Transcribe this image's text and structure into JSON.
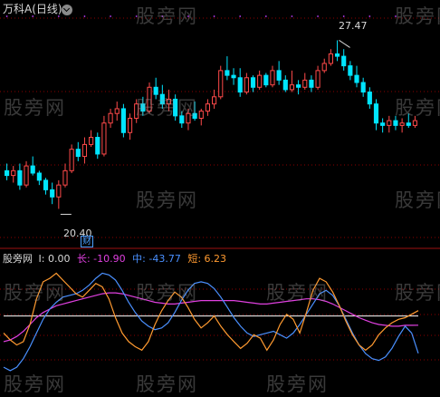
{
  "header": {
    "title": "万科A(日线)"
  },
  "indicator": {
    "name": "股旁网",
    "i_label": "I:",
    "i_value": "0.00",
    "long_label": "长:",
    "long_value": "-10.90",
    "mid_label": "中:",
    "mid_value": "-43.77",
    "short_label": "短:",
    "short_value": "6.23"
  },
  "annotations": {
    "high_label": "27.47",
    "low_label": "20.40",
    "cai_label": "财"
  },
  "watermark": "股旁网",
  "colors": {
    "up": "#ff4a4a",
    "down": "#00e5ff",
    "long": "#e040e0",
    "mid": "#4a90ff",
    "short": "#ff9a30",
    "zero": "#ffffff",
    "grid": "#8b0000",
    "title": "#d8d8d8"
  },
  "chart_data": [
    {
      "type": "candlestick",
      "title": "万科A(日线)",
      "ylim": [
        19.2,
        28.4
      ],
      "annotated_high": 27.47,
      "annotated_low": 20.4,
      "ohlc": [
        [
          22.0,
          22.3,
          21.6,
          21.8
        ],
        [
          21.8,
          22.2,
          21.5,
          22.0
        ],
        [
          22.0,
          22.3,
          21.2,
          21.4
        ],
        [
          21.4,
          22.4,
          21.3,
          22.2
        ],
        [
          22.2,
          22.6,
          21.8,
          21.9
        ],
        [
          21.9,
          22.0,
          21.4,
          21.6
        ],
        [
          21.6,
          21.7,
          21.0,
          21.2
        ],
        [
          21.2,
          21.5,
          20.6,
          20.9
        ],
        [
          20.9,
          21.6,
          20.4,
          21.4
        ],
        [
          21.4,
          22.3,
          21.3,
          22.0
        ],
        [
          22.0,
          23.1,
          21.9,
          22.9
        ],
        [
          22.9,
          23.2,
          22.4,
          22.6
        ],
        [
          22.6,
          23.4,
          22.3,
          23.1
        ],
        [
          23.1,
          23.7,
          23.0,
          23.4
        ],
        [
          23.4,
          23.6,
          22.5,
          22.7
        ],
        [
          22.7,
          24.3,
          22.6,
          24.0
        ],
        [
          24.0,
          24.6,
          23.8,
          24.4
        ],
        [
          24.4,
          24.9,
          24.1,
          24.6
        ],
        [
          24.6,
          24.8,
          23.4,
          23.6
        ],
        [
          23.6,
          24.4,
          23.3,
          24.2
        ],
        [
          24.2,
          25.0,
          24.0,
          24.8
        ],
        [
          24.8,
          25.1,
          24.3,
          24.5
        ],
        [
          24.5,
          25.7,
          24.4,
          25.5
        ],
        [
          25.5,
          25.9,
          25.0,
          25.2
        ],
        [
          25.2,
          25.6,
          24.6,
          24.8
        ],
        [
          24.8,
          25.4,
          24.5,
          25.0
        ],
        [
          25.0,
          25.2,
          24.1,
          24.3
        ],
        [
          24.3,
          24.5,
          23.8,
          24.0
        ],
        [
          24.0,
          24.6,
          23.7,
          24.4
        ],
        [
          24.4,
          24.9,
          24.1,
          24.2
        ],
        [
          24.2,
          24.6,
          23.9,
          24.5
        ],
        [
          24.5,
          25.0,
          24.3,
          24.8
        ],
        [
          24.8,
          25.4,
          24.6,
          25.1
        ],
        [
          25.1,
          26.4,
          25.0,
          26.2
        ],
        [
          26.2,
          26.8,
          25.8,
          26.0
        ],
        [
          26.0,
          26.3,
          25.6,
          25.9
        ],
        [
          25.9,
          26.3,
          25.1,
          25.3
        ],
        [
          25.3,
          26.1,
          25.2,
          25.9
        ],
        [
          25.9,
          26.0,
          25.3,
          25.5
        ],
        [
          25.5,
          26.2,
          25.4,
          26.0
        ],
        [
          26.0,
          26.1,
          25.5,
          25.6
        ],
        [
          25.6,
          26.4,
          25.5,
          26.2
        ],
        [
          26.2,
          26.6,
          25.6,
          25.8
        ],
        [
          25.8,
          26.0,
          25.3,
          25.4
        ],
        [
          25.4,
          26.2,
          25.3,
          25.6
        ],
        [
          25.6,
          25.8,
          25.2,
          25.5
        ],
        [
          25.5,
          26.1,
          25.4,
          25.8
        ],
        [
          25.8,
          26.0,
          25.3,
          25.5
        ],
        [
          25.5,
          26.4,
          25.4,
          26.2
        ],
        [
          26.2,
          26.7,
          26.1,
          26.5
        ],
        [
          26.5,
          27.1,
          26.4,
          26.9
        ],
        [
          26.9,
          27.47,
          26.6,
          26.8
        ],
        [
          26.8,
          27.1,
          26.2,
          26.4
        ],
        [
          26.4,
          26.6,
          25.8,
          26.0
        ],
        [
          26.0,
          26.4,
          25.5,
          25.7
        ],
        [
          25.7,
          25.9,
          25.1,
          25.3
        ],
        [
          25.3,
          25.5,
          24.6,
          24.8
        ],
        [
          24.8,
          25.0,
          23.7,
          24.0
        ],
        [
          24.0,
          24.2,
          23.6,
          23.9
        ],
        [
          23.9,
          24.3,
          23.6,
          24.1
        ],
        [
          24.1,
          24.3,
          23.7,
          23.9
        ],
        [
          23.9,
          24.2,
          23.6,
          24.0
        ],
        [
          24.0,
          24.4,
          23.8,
          23.9
        ],
        [
          23.9,
          24.3,
          23.8,
          24.1
        ]
      ]
    },
    {
      "type": "line",
      "title": "股旁网",
      "ylim": [
        -80,
        60
      ],
      "series": [
        {
          "name": "I",
          "values": [
            0.0
          ]
        },
        {
          "name": "长",
          "values": [
            -30,
            -28,
            -24,
            -18,
            -10,
            -2,
            4,
            8,
            12,
            14,
            16,
            18,
            20,
            22,
            24,
            26,
            27,
            27,
            26,
            24,
            22,
            20,
            18,
            16,
            15,
            14,
            14,
            15,
            16,
            17,
            18,
            18,
            18,
            18,
            18,
            18,
            17,
            16,
            15,
            14,
            14,
            15,
            16,
            17,
            18,
            19,
            20,
            20,
            19,
            17,
            14,
            10,
            6,
            2,
            -2,
            -5,
            -8,
            -10,
            -11,
            -12,
            -12,
            -11,
            -11,
            -10.9
          ]
        },
        {
          "name": "中",
          "values": [
            -60,
            -64,
            -60,
            -50,
            -36,
            -20,
            -4,
            8,
            16,
            22,
            24,
            26,
            30,
            36,
            44,
            50,
            48,
            42,
            30,
            16,
            4,
            -6,
            -12,
            -16,
            -14,
            -8,
            4,
            18,
            30,
            38,
            40,
            38,
            32,
            22,
            10,
            -2,
            -12,
            -20,
            -24,
            -22,
            -20,
            -18,
            -22,
            -26,
            -20,
            -10,
            2,
            14,
            26,
            30,
            24,
            12,
            -4,
            -20,
            -34,
            -44,
            -50,
            -52,
            -48,
            -38,
            -24,
            -12,
            -20,
            -43.77
          ]
        },
        {
          "name": "短",
          "values": [
            -20,
            -28,
            -34,
            -30,
            -10,
            20,
            40,
            44,
            50,
            42,
            34,
            26,
            22,
            30,
            38,
            34,
            20,
            -2,
            -20,
            -30,
            -36,
            -40,
            -30,
            -10,
            6,
            18,
            28,
            22,
            10,
            -4,
            -14,
            -8,
            0,
            -12,
            -22,
            -30,
            -38,
            -32,
            -22,
            -26,
            -40,
            -28,
            -10,
            2,
            -4,
            -20,
            4,
            30,
            44,
            40,
            28,
            12,
            -6,
            -22,
            -34,
            -40,
            -34,
            -22,
            -14,
            -8,
            -4,
            -2,
            2,
            6.23
          ]
        }
      ]
    }
  ]
}
